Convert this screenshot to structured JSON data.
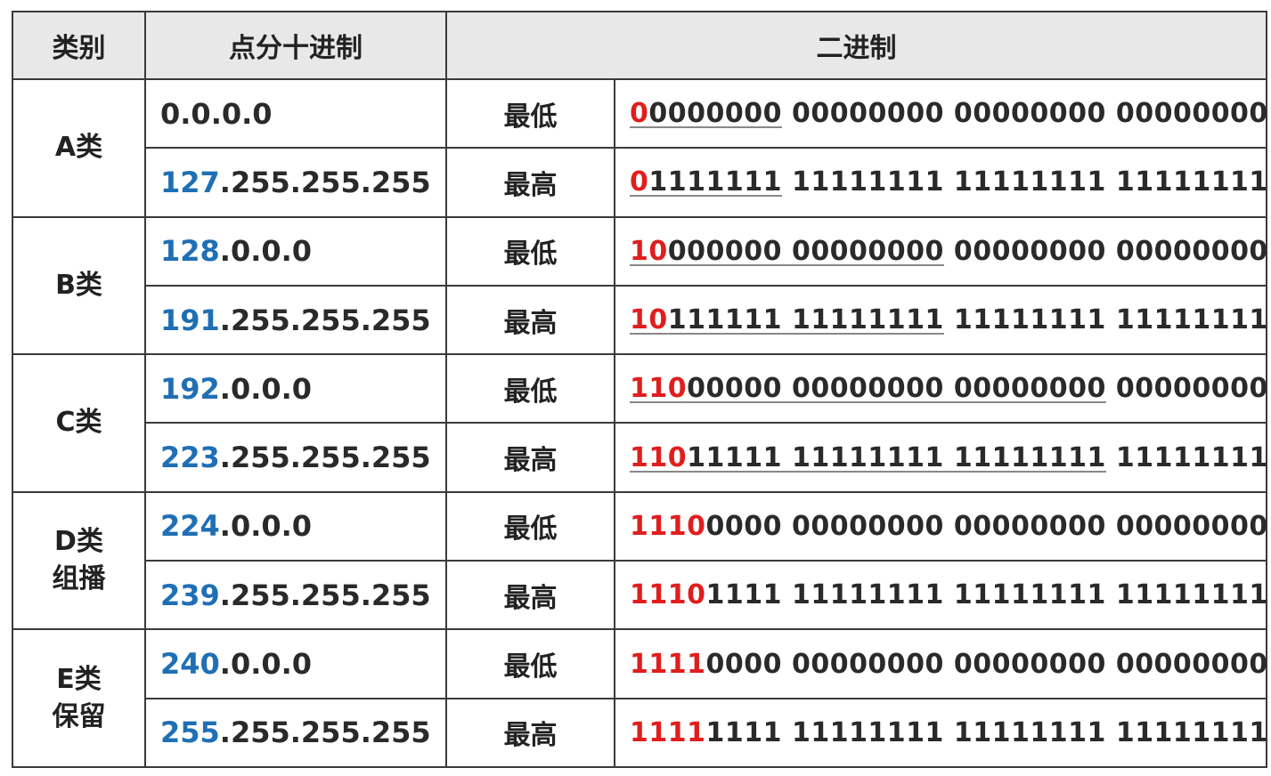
{
  "header": {
    "category": "类别",
    "dotted_decimal": "点分十进制",
    "binary": "二进制"
  },
  "classes": [
    {
      "label_line1": "A类",
      "label_line2": "",
      "rows": [
        {
          "net": "",
          "rest": "0.0.0.0",
          "bound": "最低",
          "lead": "0",
          "ul": "0000000",
          "after": " 00000000 00000000 00000000"
        },
        {
          "net": "127",
          "rest": ".255.255.255",
          "bound": "最高",
          "lead": "0",
          "ul": "1111111",
          "after": " 11111111 11111111 11111111"
        }
      ]
    },
    {
      "label_line1": "B类",
      "label_line2": "",
      "rows": [
        {
          "net": "128",
          "rest": ".0.0.0",
          "bound": "最低",
          "lead": "10",
          "ul": "000000 00000000",
          "after": " 00000000 00000000"
        },
        {
          "net": "191",
          "rest": ".255.255.255",
          "bound": "最高",
          "lead": "10",
          "ul": "111111 11111111",
          "after": " 11111111 11111111"
        }
      ]
    },
    {
      "label_line1": "C类",
      "label_line2": "",
      "rows": [
        {
          "net": "192",
          "rest": ".0.0.0",
          "bound": "最低",
          "lead": "110",
          "ul": "00000 00000000 00000000",
          "after": " 00000000"
        },
        {
          "net": "223",
          "rest": ".255.255.255",
          "bound": "最高",
          "lead": "110",
          "ul": "11111 11111111 11111111",
          "after": " 11111111"
        }
      ]
    },
    {
      "label_line1": "D类",
      "label_line2": "组播",
      "rows": [
        {
          "net": "224",
          "rest": ".0.0.0",
          "bound": "最低",
          "lead": "1110",
          "ul": "",
          "after": "0000 00000000 00000000 00000000"
        },
        {
          "net": "239",
          "rest": ".255.255.255",
          "bound": "最高",
          "lead": "1110",
          "ul": "",
          "after": "1111 11111111 11111111 11111111"
        }
      ]
    },
    {
      "label_line1": "E类",
      "label_line2": "保留",
      "rows": [
        {
          "net": "240",
          "rest": ".0.0.0",
          "bound": "最低",
          "lead": "1111",
          "ul": "",
          "after": "0000 00000000 00000000 00000000"
        },
        {
          "net": "255",
          "rest": ".255.255.255",
          "bound": "最高",
          "lead": "1111",
          "ul": "",
          "after": "1111 11111111 11111111 11111111"
        }
      ]
    }
  ],
  "colors": {
    "network_decimal": "#1f6fb5",
    "class_bits": "#e01e1e",
    "header_bg": "#e8e8e8"
  }
}
